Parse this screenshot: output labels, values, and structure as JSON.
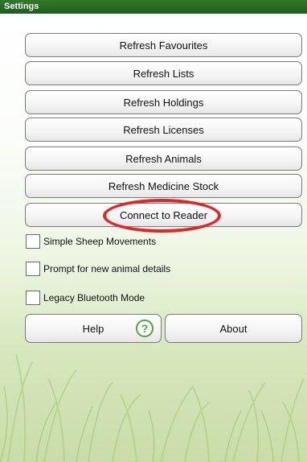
{
  "window": {
    "title": "Settings"
  },
  "buttons": {
    "refresh_favourites": "Refresh Favourites",
    "refresh_lists": "Refresh Lists",
    "refresh_holdings": "Refresh Holdings",
    "refresh_licenses": "Refresh Licenses",
    "refresh_animals": "Refresh Animals",
    "refresh_medicine_stock": "Refresh Medicine Stock",
    "connect_to_reader": "Connect to Reader"
  },
  "options": {
    "simple_sheep_movements": "Simple Sheep Movements",
    "prompt_new_animal_details": "Prompt for new animal details",
    "legacy_bluetooth_mode": "Legacy Bluetooth Mode"
  },
  "footer": {
    "help_label": "Help",
    "help_icon_glyph": "?",
    "about_label": "About"
  },
  "colors": {
    "titlebar": "#1f5d1d",
    "highlight_ring": "#e02626",
    "help_icon": "#4aa83a"
  }
}
